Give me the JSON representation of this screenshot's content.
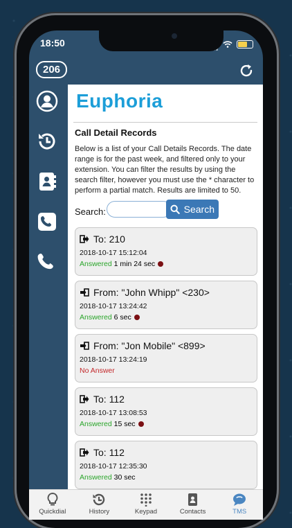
{
  "status": {
    "time": "18:50"
  },
  "header": {
    "extension": "206"
  },
  "logo": {
    "text": "Euphoria"
  },
  "page": {
    "title": "Call Detail Records",
    "description": "Below is a list of your Call Details Records. The date range is for the past week, and filtered only to your extension. You can filter the results by using the search filter, however you must use the * character to perform a partial match. Results are limited to 50."
  },
  "search": {
    "label": "Search:",
    "value": "",
    "placeholder": "",
    "button_label": "Search"
  },
  "records": [
    {
      "direction": "out",
      "head": "To: 210",
      "date": "2018-10-17 15:12:04",
      "status_word": "Answered",
      "duration": "1 min 24 sec",
      "recording": true
    },
    {
      "direction": "in",
      "head": "From: \"John Whipp\" <230>",
      "date": "2018-10-17 13:24:42",
      "status_word": "Answered",
      "duration": "6 sec",
      "recording": true
    },
    {
      "direction": "in",
      "head": "From: \"Jon Mobile\" <899>",
      "date": "2018-10-17 13:24:19",
      "status_word": "No Answer",
      "duration": "",
      "recording": false
    },
    {
      "direction": "out",
      "head": "To: 112",
      "date": "2018-10-17 13:08:53",
      "status_word": "Answered",
      "duration": "15 sec",
      "recording": true
    },
    {
      "direction": "out",
      "head": "To: 112",
      "date": "2018-10-17 12:35:30",
      "status_word": "Answered",
      "duration": "30 sec",
      "recording": false
    }
  ],
  "tabs": [
    {
      "label": "Quickdial",
      "icon": "lightbulb-icon"
    },
    {
      "label": "History",
      "icon": "history-icon"
    },
    {
      "label": "Keypad",
      "icon": "keypad-icon"
    },
    {
      "label": "Contacts",
      "icon": "contacts-icon"
    },
    {
      "label": "TMS",
      "icon": "chat-icon"
    }
  ],
  "colors": {
    "brand": "#1c9ed8",
    "answered": "#2aa52a",
    "no_answer": "#c3292b",
    "sidebar": "#2d4f6c",
    "active_tab": "#4a86c1"
  }
}
